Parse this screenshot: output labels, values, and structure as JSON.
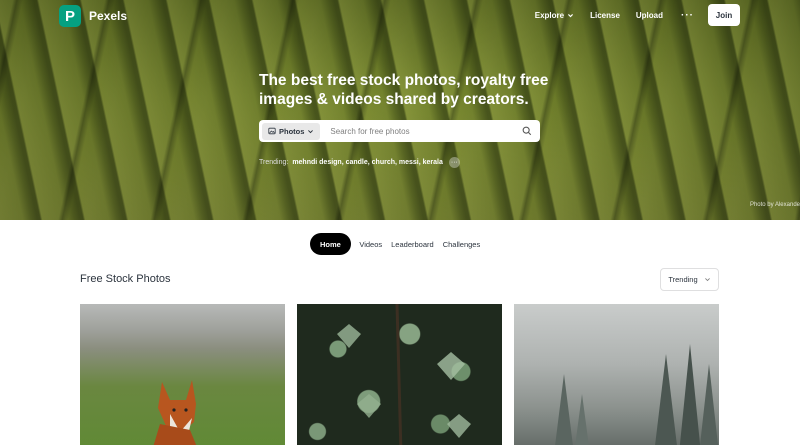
{
  "brand": {
    "name": "Pexels",
    "mark": "P",
    "accent": "#05a081"
  },
  "topnav": {
    "explore": "Explore",
    "license": "License",
    "upload": "Upload",
    "more": "···",
    "join": "Join"
  },
  "hero": {
    "headline": "The best free stock photos, royalty free images & videos shared by creators.",
    "search": {
      "type": "Photos",
      "placeholder": "Search for free photos"
    },
    "trending_label": "Trending:",
    "trending_terms": "mehndi design, candle, church, messi, kerala",
    "trending_more": "···",
    "credit": "Photo by Alexande"
  },
  "tabs": [
    {
      "label": "Home",
      "active": true
    },
    {
      "label": "Videos",
      "active": false
    },
    {
      "label": "Leaderboard",
      "active": false
    },
    {
      "label": "Challenges",
      "active": false
    }
  ],
  "section": {
    "title": "Free Stock Photos",
    "sort": "Trending"
  },
  "photos": [
    {
      "subject": "fox in grass"
    },
    {
      "subject": "ivy leaves"
    },
    {
      "subject": "misty forest"
    }
  ]
}
